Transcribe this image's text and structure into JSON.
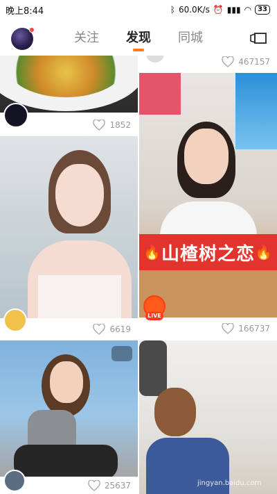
{
  "status_bar": {
    "time": "晚上8:44",
    "network_speed": "60.0K/s",
    "battery": "33"
  },
  "header": {
    "tabs": [
      "关注",
      "发现",
      "同城"
    ],
    "active_tab": "发现",
    "icons": {
      "avatar": "profile-avatar",
      "right": "layout-toggle-icon"
    },
    "accent_color": "#ff7a1a"
  },
  "feed": {
    "cards": [
      {
        "likes": "1852"
      },
      {
        "likes": "467157"
      },
      {
        "likes": "6619"
      },
      {
        "likes": "166737",
        "banner": "山楂树之恋",
        "badge": "LIVE"
      },
      {
        "likes": "25637"
      },
      {
        "likes": ""
      }
    ]
  },
  "watermark": "jingyan.baidu.com"
}
